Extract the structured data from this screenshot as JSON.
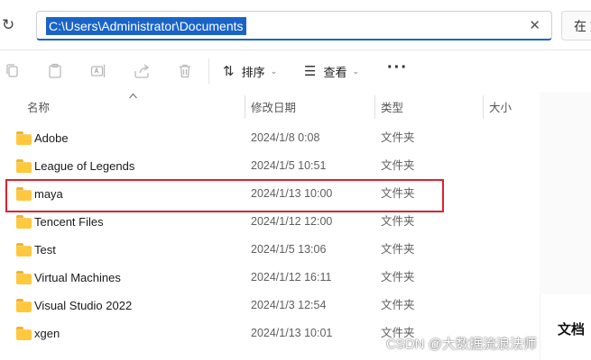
{
  "address_bar": {
    "path": "C:\\Users\\Administrator\\Documents",
    "clear_icon": "close-icon",
    "refresh_icon": "refresh-icon"
  },
  "search": {
    "placeholder": "在 文"
  },
  "toolbar": {
    "icons": [
      "copy-icon",
      "paste-icon",
      "rename-icon",
      "share-icon",
      "delete-icon"
    ],
    "sort_label": "排序",
    "view_label": "查看",
    "more_label": "···"
  },
  "columns": {
    "name": "名称",
    "date": "修改日期",
    "type": "类型",
    "size": "大小"
  },
  "rows": [
    {
      "name": "Adobe",
      "date": "2024/1/8 0:08",
      "type": "文件夹"
    },
    {
      "name": "League of Legends",
      "date": "2024/1/5 10:51",
      "type": "文件夹"
    },
    {
      "name": "maya",
      "date": "2024/1/13 10:00",
      "type": "文件夹"
    },
    {
      "name": "Tencent Files",
      "date": "2024/1/12 12:00",
      "type": "文件夹"
    },
    {
      "name": "Test",
      "date": "2024/1/5 13:06",
      "type": "文件夹"
    },
    {
      "name": "Virtual Machines",
      "date": "2024/1/12 16:11",
      "type": "文件夹"
    },
    {
      "name": "Visual Studio 2022",
      "date": "2024/1/3 12:54",
      "type": "文件夹"
    },
    {
      "name": "xgen",
      "date": "2024/1/13 10:01",
      "type": "文件夹"
    }
  ],
  "preview": {
    "title": "文档"
  },
  "watermark": "CSDN @大数据流浪法师",
  "colors": {
    "accent": "#1a64c8",
    "highlight_border": "#d9232d",
    "folder": "#ffc83d"
  }
}
